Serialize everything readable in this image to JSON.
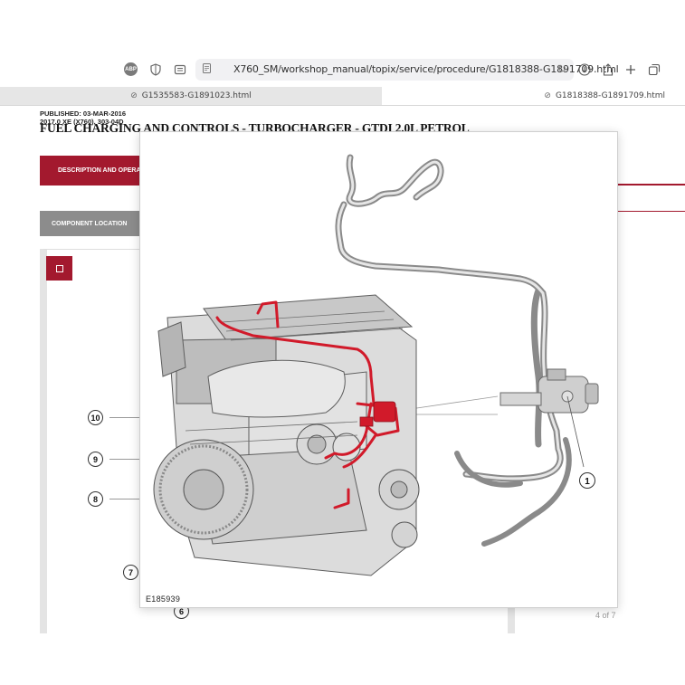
{
  "browser": {
    "url": "X760_SM/workshop_manual/topix/service/procedure/G1818388-G1891709.html",
    "abp_label": "ABP",
    "tabs": [
      {
        "label": "G1535583-G1891023.html"
      },
      {
        "label": "G1818388-G1891709.html"
      }
    ]
  },
  "document": {
    "published": "PUBLISHED: 03-MAR-2016",
    "model_line": "2017.0 XE (X760), 303-04D",
    "title": "FUEL CHARGING AND CONTROLS - TURBOCHARGER - GTDI 2.0L PETROL",
    "desc_button": "DESCRIPTION AND OPERATION",
    "component_button": "COMPONENT LOCATION",
    "page_indicator": "4 of 7"
  },
  "callouts_bg": [
    "10",
    "9",
    "8",
    "7",
    "6"
  ],
  "overlay": {
    "figure_code": "E185939",
    "callout": "1"
  },
  "colors": {
    "accent_red": "#a3192e",
    "button_gray": "#8c8c8c",
    "highlight_red": "#d11a2a"
  }
}
